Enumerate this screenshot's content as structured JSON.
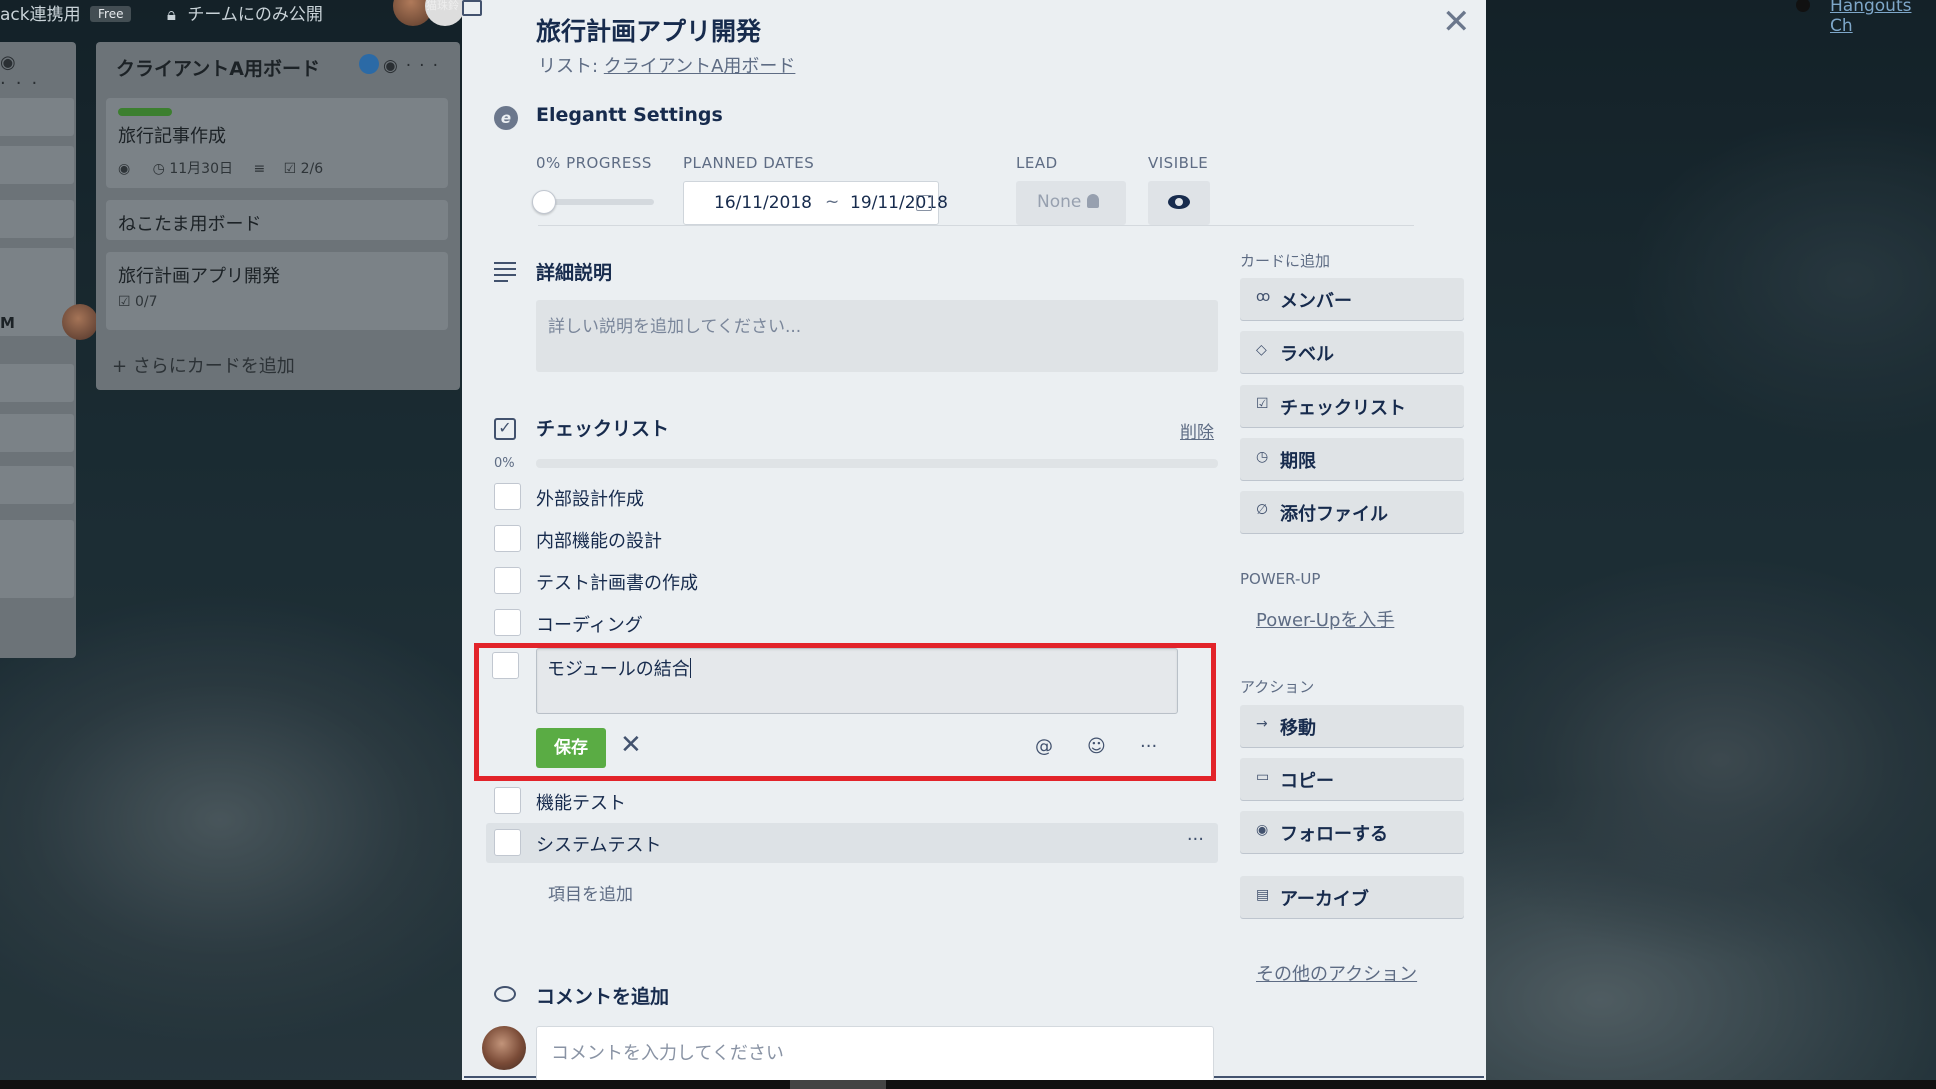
{
  "background": {
    "topbar_left": "ack連携用",
    "topbar_free": "Free",
    "topbar_team": "チームにのみ公開",
    "topbar_name": "猫珠鈴",
    "topbar_right": "Hangouts Ch",
    "left_list_m": "M",
    "client_list": {
      "title": "クライアントA用ボード",
      "cards": [
        {
          "title": "旅行記事作成",
          "due": "11月30日",
          "checklist": "2/6"
        },
        {
          "title": "ねこたま用ボード"
        },
        {
          "title": "旅行計画アプリ開発",
          "checklist": "0/7"
        }
      ],
      "add_card": "+ さらにカードを追加"
    }
  },
  "modal": {
    "title": "旅行計画アプリ開発",
    "list_prefix": "リスト: ",
    "list_name": "クライアントA用ボード",
    "elegantt": {
      "title": "Elegantt Settings",
      "progress_label": "0% PROGRESS",
      "progress_value": 0,
      "planned_label": "PLANNED DATES",
      "date_start": "16/11/2018",
      "date_sep": "~",
      "date_end": "19/11/2018",
      "lead_label": "LEAD",
      "lead_value": "None",
      "visible_label": "VISIBLE"
    },
    "description": {
      "title": "詳細説明",
      "placeholder": "詳しい説明を追加してください..."
    },
    "checklist": {
      "title": "チェックリスト",
      "delete": "削除",
      "percent": "0%",
      "items": [
        "外部設計作成",
        "内部機能の設計",
        "テスト計画書の作成",
        "コーディング"
      ],
      "editing_value": "モジュールの結合",
      "save": "保存",
      "tool_mention": "@",
      "tool_emoji": "☺",
      "tool_more": "···",
      "items_after": [
        "機能テスト",
        "システムテスト"
      ],
      "row_more": "···",
      "add_item": "項目を追加"
    },
    "comment": {
      "title": "コメントを追加",
      "placeholder": "コメントを入力してください"
    },
    "sidebar": {
      "add_label": "カードに追加",
      "add_buttons": [
        {
          "icon": "ꝏ",
          "label": "メンバー"
        },
        {
          "icon": "◇",
          "label": "ラベル"
        },
        {
          "icon": "☑",
          "label": "チェックリスト"
        },
        {
          "icon": "◷",
          "label": "期限"
        },
        {
          "icon": "∅",
          "label": "添付ファイル"
        }
      ],
      "powerup_label": "POWER-UP",
      "powerup_link": "Power-Upを入手",
      "actions_label": "アクション",
      "action_buttons": [
        {
          "icon": "→",
          "label": "移動"
        },
        {
          "icon": "▭",
          "label": "コピー"
        },
        {
          "icon": "◉",
          "label": "フォローする"
        },
        {
          "icon": "▤",
          "label": "アーカイブ"
        }
      ],
      "more_actions": "その他のアクション"
    }
  }
}
